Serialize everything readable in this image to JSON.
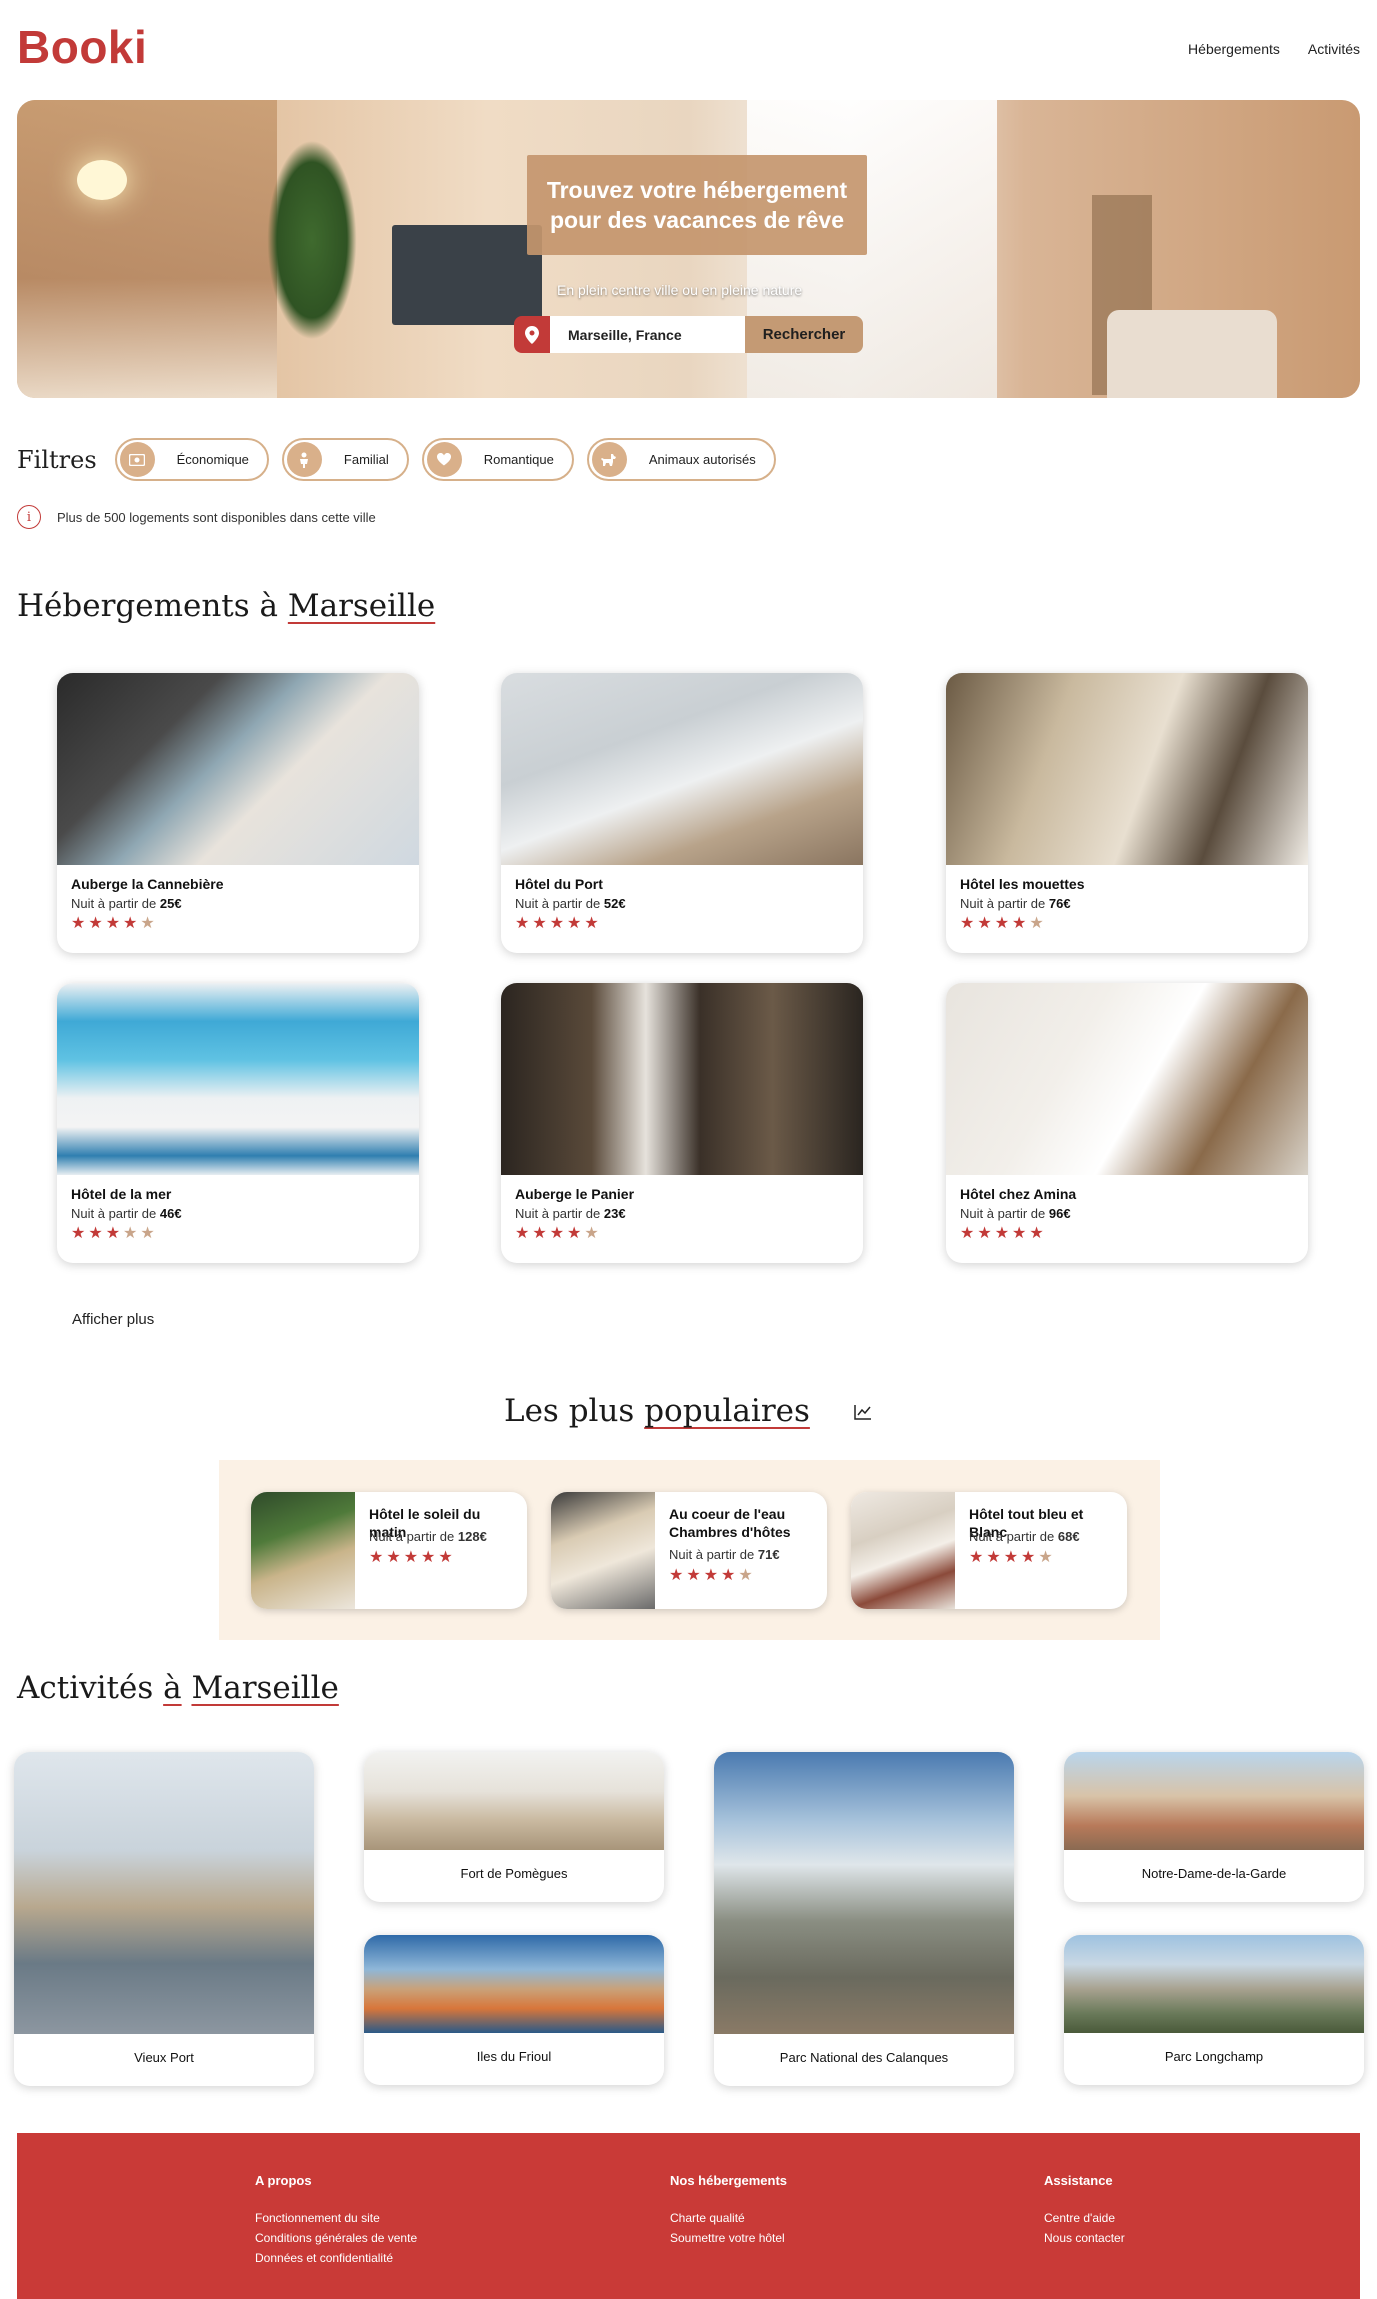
{
  "header": {
    "logo": "Booki",
    "nav": [
      "Hébergements",
      "Activités"
    ]
  },
  "hero": {
    "title": "Trouvez votre hébergement pour des vacances de rêve",
    "subtitle": "En plein centre ville ou en pleine nature",
    "search_value": "Marseille, France",
    "search_button": "Rechercher",
    "pin_icon": "location-pin-icon"
  },
  "filters": {
    "label": "Filtres",
    "items": [
      {
        "label": "Économique",
        "icon": "money-icon"
      },
      {
        "label": "Familial",
        "icon": "family-icon"
      },
      {
        "label": "Romantique",
        "icon": "heart-icon"
      },
      {
        "label": "Animaux autorisés",
        "icon": "dog-icon"
      }
    ],
    "info": "Plus de 500 logements sont disponibles dans cette ville"
  },
  "hebergements": {
    "title_prefix": "Hébergements à ",
    "title_city": "Marseille",
    "price_prefix": "Nuit à partir de ",
    "items": [
      {
        "name": "Auberge la Cannebière",
        "price": "25€",
        "rating": 4
      },
      {
        "name": "Hôtel du Port",
        "price": "52€",
        "rating": 5
      },
      {
        "name": "Hôtel les mouettes",
        "price": "76€",
        "rating": 4
      },
      {
        "name": "Hôtel de la mer",
        "price": "46€",
        "rating": 3
      },
      {
        "name": "Auberge le Panier",
        "price": "23€",
        "rating": 4
      },
      {
        "name": "Hôtel chez Amina",
        "price": "96€",
        "rating": 5
      }
    ],
    "more": "Afficher plus"
  },
  "populaires": {
    "title_prefix": "Les plus ",
    "title_word": "populaires",
    "icon": "trend-chart-icon",
    "items": [
      {
        "name": "Hôtel le soleil du matin",
        "price": "128€",
        "rating": 5
      },
      {
        "name": "Au coeur de l'eau Chambres d'hôtes",
        "price": "71€",
        "rating": 4
      },
      {
        "name": "Hôtel tout bleu et Blanc",
        "price": "68€",
        "rating": 4
      }
    ]
  },
  "activites": {
    "title_prefix": "Activités ",
    "title_a": "à",
    "title_city": "Marseille",
    "items": [
      {
        "name": "Vieux Port"
      },
      {
        "name": "Fort de Pomègues"
      },
      {
        "name": "Iles du Frioul"
      },
      {
        "name": "Parc National des Calanques"
      },
      {
        "name": "Notre-Dame-de-la-Garde"
      },
      {
        "name": "Parc Longchamp"
      }
    ]
  },
  "footer": {
    "columns": [
      {
        "title": "A propos",
        "links": [
          "Fonctionnement du site",
          "Conditions générales de vente",
          "Données et confidentialité"
        ]
      },
      {
        "title": "Nos hébergements",
        "links": [
          "Charte qualité",
          "Soumettre votre hôtel"
        ]
      },
      {
        "title": "Assistance",
        "links": [
          "Centre d'aide",
          "Nous contacter"
        ]
      }
    ]
  },
  "colors": {
    "brand": "#c23a38",
    "accent": "#c49a74",
    "light": "#fbf1e5"
  }
}
